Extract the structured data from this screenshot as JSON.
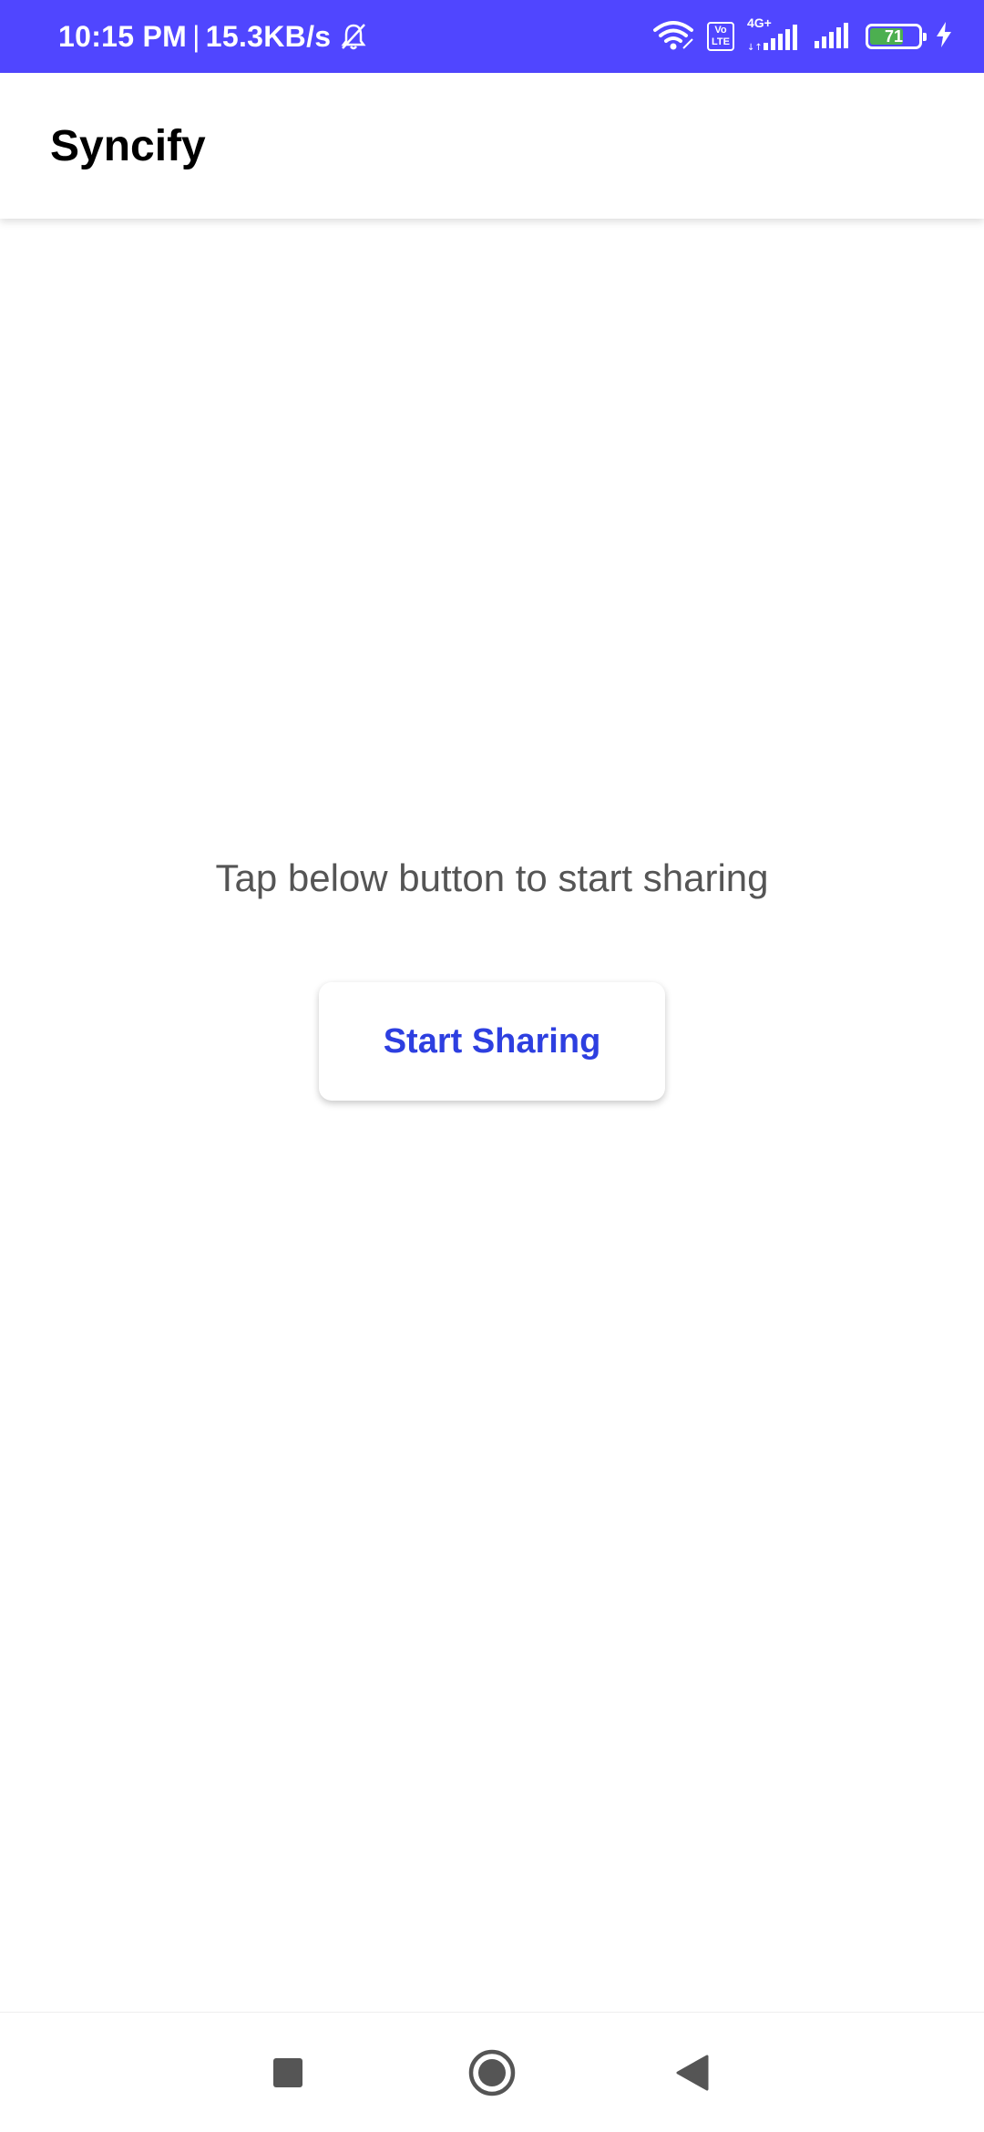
{
  "status_bar": {
    "time": "10:15 PM",
    "separator": "|",
    "net_speed": "15.3KB/s",
    "volte_top": "Vo",
    "volte_bottom": "LTE",
    "network_type": "4G+",
    "battery_level": "71",
    "battery_fraction": 0.71,
    "icons": [
      "bell-off-icon",
      "wifi-icon",
      "volte-icon",
      "signal-icon",
      "signal-icon",
      "battery-icon",
      "charging-icon"
    ],
    "background_color": "#5046ff"
  },
  "app_bar": {
    "title": "Syncify"
  },
  "main": {
    "hint_text": "Tap below button to start sharing",
    "start_button_label": "Start Sharing",
    "accent_color": "#2d3fe0"
  },
  "nav_bar": {
    "icons": [
      "recents-square-icon",
      "home-circle-icon",
      "back-triangle-icon"
    ]
  }
}
